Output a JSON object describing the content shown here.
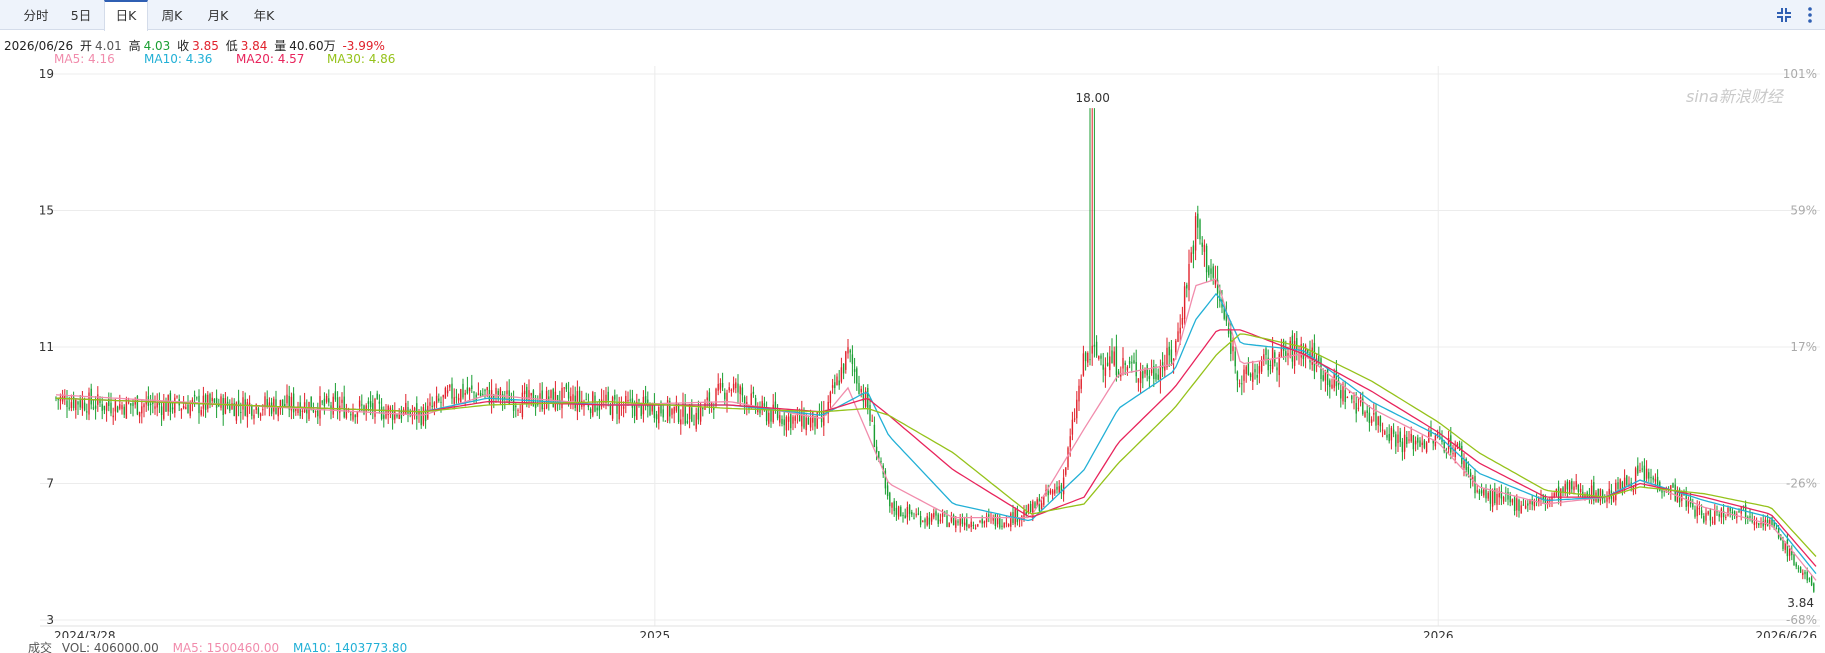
{
  "tabs": [
    {
      "label": "分时",
      "active": false
    },
    {
      "label": "5日",
      "active": false
    },
    {
      "label": "日K",
      "active": true
    },
    {
      "label": "周K",
      "active": false
    },
    {
      "label": "月K",
      "active": false
    },
    {
      "label": "年K",
      "active": false
    }
  ],
  "info": {
    "date": "2026/06/26",
    "open_label": "开",
    "open": "4.01",
    "high_label": "高",
    "high": "4.03",
    "close_label": "收",
    "close": "3.85",
    "low_label": "低",
    "low": "3.84",
    "vol_label": "量",
    "vol": "40.60万",
    "change": "-3.99%"
  },
  "ma": {
    "ma5": "MA5: 4.16",
    "ma10": "MA10: 4.36",
    "ma20": "MA20: 4.57",
    "ma30": "MA30: 4.86"
  },
  "colors": {
    "up": "#e0212b",
    "down": "#1a9e32",
    "ma5": "#f18cac",
    "ma10": "#22b0d6",
    "ma20": "#e8245c",
    "ma30": "#95c21a"
  },
  "volume": {
    "label": "成交",
    "vol": "VOL: 406000.00",
    "ma5": "MA5: 1500460.00",
    "ma10": "MA10: 1403773.80"
  },
  "watermark": "sina新浪财经",
  "chart_data": {
    "type": "candlestick",
    "title": "",
    "x_range": [
      "2024-03-28",
      "2026-06-26"
    ],
    "x_tick_labels": [
      "2024/3/28",
      "2025",
      "2026",
      "2026/6/26"
    ],
    "y_range": [
      3,
      19
    ],
    "y_ticks": [
      19,
      15,
      11,
      7,
      3
    ],
    "y_right_ticks": [
      "101%",
      "59%",
      "17%",
      "-26%",
      "-68%"
    ],
    "grid": true,
    "annotations": [
      {
        "label": "18.00",
        "date": "2025-07-24",
        "value": 18.0
      },
      {
        "label": "3.84",
        "date": "2026-06-26",
        "value": 3.84
      }
    ],
    "series": [
      {
        "name": "close",
        "points": [
          [
            "2024-03-28",
            9.5
          ],
          [
            "2024-04-20",
            9.3
          ],
          [
            "2024-05-20",
            9.3
          ],
          [
            "2024-06-20",
            9.3
          ],
          [
            "2024-07-20",
            9.3
          ],
          [
            "2024-08-20",
            9.2
          ],
          [
            "2024-09-15",
            9.0
          ],
          [
            "2024-09-30",
            9.7
          ],
          [
            "2024-10-15",
            9.6
          ],
          [
            "2024-11-01",
            9.4
          ],
          [
            "2024-11-20",
            9.5
          ],
          [
            "2024-12-10",
            9.3
          ],
          [
            "2025-01-01",
            9.2
          ],
          [
            "2025-01-20",
            9.0
          ],
          [
            "2025-02-05",
            9.9
          ],
          [
            "2025-02-20",
            9.1
          ],
          [
            "2025-03-05",
            8.9
          ],
          [
            "2025-03-20",
            8.8
          ],
          [
            "2025-04-01",
            10.8
          ],
          [
            "2025-04-10",
            9.3
          ],
          [
            "2025-04-20",
            6.3
          ],
          [
            "2025-05-05",
            6.0
          ],
          [
            "2025-05-20",
            5.9
          ],
          [
            "2025-06-10",
            5.9
          ],
          [
            "2025-06-25",
            6.2
          ],
          [
            "2025-07-10",
            7.0
          ],
          [
            "2025-07-20",
            10.6
          ],
          [
            "2025-07-24",
            10.8
          ],
          [
            "2025-08-05",
            10.5
          ],
          [
            "2025-08-20",
            10.2
          ],
          [
            "2025-08-31",
            10.8
          ],
          [
            "2025-09-10",
            14.5
          ],
          [
            "2025-09-20",
            12.6
          ],
          [
            "2025-10-01",
            10.0
          ],
          [
            "2025-10-15",
            10.6
          ],
          [
            "2025-10-30",
            11.0
          ],
          [
            "2025-11-15",
            9.8
          ],
          [
            "2025-12-01",
            9.0
          ],
          [
            "2025-12-15",
            8.2
          ],
          [
            "2026-01-01",
            8.3
          ],
          [
            "2026-01-10",
            8.0
          ],
          [
            "2026-01-20",
            6.7
          ],
          [
            "2026-02-05",
            6.4
          ],
          [
            "2026-02-20",
            6.5
          ],
          [
            "2026-03-05",
            6.9
          ],
          [
            "2026-03-20",
            6.6
          ],
          [
            "2026-04-05",
            7.3
          ],
          [
            "2026-04-20",
            6.8
          ],
          [
            "2026-05-05",
            6.0
          ],
          [
            "2026-05-20",
            6.3
          ],
          [
            "2026-06-05",
            5.8
          ],
          [
            "2026-06-20",
            4.3
          ],
          [
            "2026-06-26",
            3.85
          ]
        ]
      },
      {
        "name": "MA5",
        "points": [
          [
            "2024-03-28",
            9.6
          ],
          [
            "2024-06-20",
            9.3
          ],
          [
            "2024-09-15",
            9.0
          ],
          [
            "2024-10-15",
            9.6
          ],
          [
            "2024-12-10",
            9.3
          ],
          [
            "2025-02-05",
            9.4
          ],
          [
            "2025-03-20",
            8.9
          ],
          [
            "2025-04-01",
            9.8
          ],
          [
            "2025-04-20",
            7.0
          ],
          [
            "2025-05-20",
            6.0
          ],
          [
            "2025-06-25",
            6.0
          ],
          [
            "2025-07-20",
            8.6
          ],
          [
            "2025-08-05",
            10.2
          ],
          [
            "2025-08-31",
            10.5
          ],
          [
            "2025-09-10",
            12.8
          ],
          [
            "2025-09-20",
            13.0
          ],
          [
            "2025-10-01",
            10.5
          ],
          [
            "2025-10-30",
            10.8
          ],
          [
            "2025-12-01",
            9.2
          ],
          [
            "2026-01-01",
            8.2
          ],
          [
            "2026-01-20",
            6.9
          ],
          [
            "2026-02-20",
            6.4
          ],
          [
            "2026-03-20",
            6.6
          ],
          [
            "2026-04-05",
            7.1
          ],
          [
            "2026-05-05",
            6.3
          ],
          [
            "2026-06-05",
            5.8
          ],
          [
            "2026-06-26",
            4.16
          ]
        ]
      },
      {
        "name": "MA10",
        "points": [
          [
            "2024-03-28",
            9.5
          ],
          [
            "2024-06-20",
            9.3
          ],
          [
            "2024-09-15",
            9.1
          ],
          [
            "2024-10-15",
            9.5
          ],
          [
            "2024-12-10",
            9.3
          ],
          [
            "2025-02-05",
            9.3
          ],
          [
            "2025-03-20",
            9.0
          ],
          [
            "2025-04-10",
            9.7
          ],
          [
            "2025-04-20",
            8.4
          ],
          [
            "2025-05-20",
            6.4
          ],
          [
            "2025-06-25",
            5.9
          ],
          [
            "2025-07-20",
            7.4
          ],
          [
            "2025-08-05",
            9.2
          ],
          [
            "2025-08-31",
            10.3
          ],
          [
            "2025-09-10",
            11.8
          ],
          [
            "2025-09-20",
            12.6
          ],
          [
            "2025-10-01",
            11.1
          ],
          [
            "2025-10-30",
            10.9
          ],
          [
            "2025-12-01",
            9.4
          ],
          [
            "2026-01-01",
            8.4
          ],
          [
            "2026-01-20",
            7.3
          ],
          [
            "2026-02-20",
            6.5
          ],
          [
            "2026-03-20",
            6.6
          ],
          [
            "2026-04-05",
            7.1
          ],
          [
            "2026-05-05",
            6.5
          ],
          [
            "2026-06-05",
            6.0
          ],
          [
            "2026-06-26",
            4.36
          ]
        ]
      },
      {
        "name": "MA20",
        "points": [
          [
            "2024-03-28",
            9.5
          ],
          [
            "2024-06-20",
            9.3
          ],
          [
            "2024-09-15",
            9.1
          ],
          [
            "2024-10-15",
            9.4
          ],
          [
            "2024-12-10",
            9.3
          ],
          [
            "2025-02-05",
            9.3
          ],
          [
            "2025-03-20",
            9.1
          ],
          [
            "2025-04-10",
            9.5
          ],
          [
            "2025-04-20",
            9.0
          ],
          [
            "2025-05-20",
            7.4
          ],
          [
            "2025-06-25",
            6.0
          ],
          [
            "2025-07-20",
            6.6
          ],
          [
            "2025-08-05",
            8.2
          ],
          [
            "2025-08-31",
            9.8
          ],
          [
            "2025-09-20",
            11.5
          ],
          [
            "2025-10-01",
            11.5
          ],
          [
            "2025-10-30",
            10.8
          ],
          [
            "2025-12-01",
            9.7
          ],
          [
            "2026-01-01",
            8.5
          ],
          [
            "2026-01-20",
            7.6
          ],
          [
            "2026-02-20",
            6.6
          ],
          [
            "2026-03-20",
            6.6
          ],
          [
            "2026-04-05",
            7.0
          ],
          [
            "2026-05-05",
            6.6
          ],
          [
            "2026-06-05",
            6.1
          ],
          [
            "2026-06-26",
            4.57
          ]
        ]
      },
      {
        "name": "MA30",
        "points": [
          [
            "2024-03-28",
            9.5
          ],
          [
            "2024-06-20",
            9.3
          ],
          [
            "2024-09-15",
            9.1
          ],
          [
            "2024-10-15",
            9.3
          ],
          [
            "2024-12-10",
            9.4
          ],
          [
            "2025-02-05",
            9.2
          ],
          [
            "2025-03-20",
            9.1
          ],
          [
            "2025-04-10",
            9.2
          ],
          [
            "2025-04-20",
            9.0
          ],
          [
            "2025-05-20",
            7.9
          ],
          [
            "2025-06-25",
            6.1
          ],
          [
            "2025-07-20",
            6.4
          ],
          [
            "2025-08-05",
            7.6
          ],
          [
            "2025-08-31",
            9.2
          ],
          [
            "2025-09-20",
            10.8
          ],
          [
            "2025-10-01",
            11.4
          ],
          [
            "2025-10-30",
            11.0
          ],
          [
            "2025-12-01",
            10.0
          ],
          [
            "2026-01-01",
            8.8
          ],
          [
            "2026-01-20",
            7.9
          ],
          [
            "2026-02-20",
            6.8
          ],
          [
            "2026-03-20",
            6.6
          ],
          [
            "2026-04-05",
            6.9
          ],
          [
            "2026-05-05",
            6.7
          ],
          [
            "2026-06-05",
            6.3
          ],
          [
            "2026-06-26",
            4.86
          ]
        ]
      }
    ]
  }
}
